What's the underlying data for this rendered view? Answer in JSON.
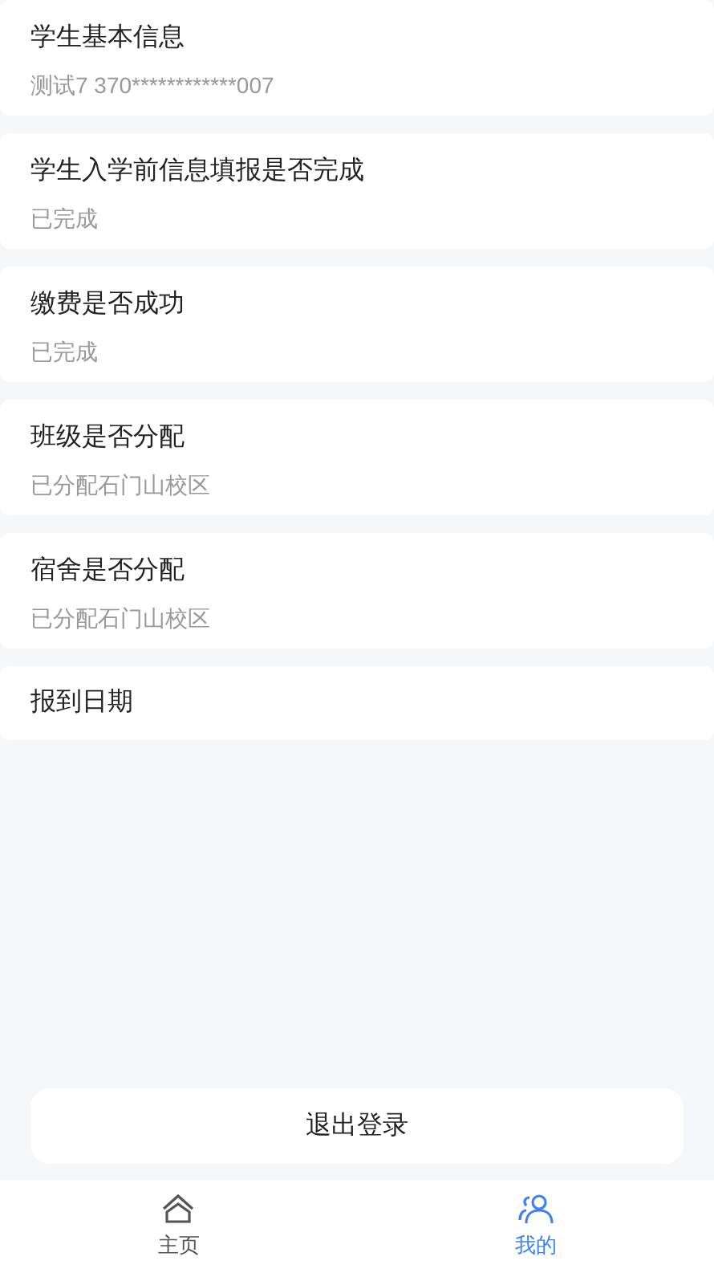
{
  "items": [
    {
      "title": "学生基本信息",
      "value": "测试7 370************007"
    },
    {
      "title": "学生入学前信息填报是否完成",
      "value": "已完成"
    },
    {
      "title": "缴费是否成功",
      "value": "已完成"
    },
    {
      "title": "班级是否分配",
      "value": "已分配石门山校区"
    },
    {
      "title": "宿舍是否分配",
      "value": "已分配石门山校区"
    },
    {
      "title": "报到日期"
    }
  ],
  "logout_button": "退出登录",
  "tab_bar": [
    {
      "kind": "home",
      "label": "主页",
      "selected": false
    },
    {
      "kind": "user",
      "label": "我的",
      "selected": true
    }
  ]
}
